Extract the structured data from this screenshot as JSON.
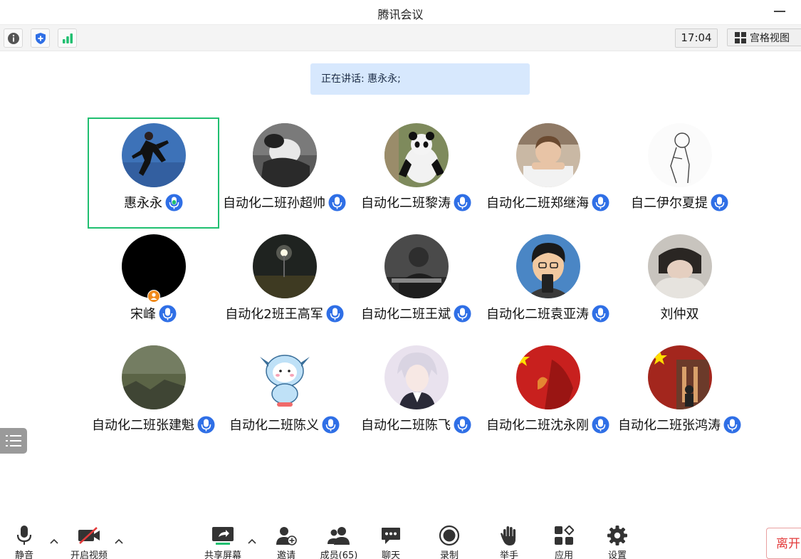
{
  "window": {
    "title": "腾讯会议"
  },
  "infobar": {
    "time": "17:04",
    "grid_view_label": "宫格视图"
  },
  "speaking": {
    "text": "正在讲话: 惠永永;"
  },
  "participants": [
    {
      "name": "惠永永",
      "mic": "speaking"
    },
    {
      "name": "自动化二班孙超帅",
      "mic": "on"
    },
    {
      "name": "自动化二班黎涛",
      "mic": "on"
    },
    {
      "name": "自动化二班郑继海",
      "mic": "on"
    },
    {
      "name": "自二伊尔夏提",
      "mic": "on"
    },
    {
      "name": "宋峰",
      "mic": "on",
      "host": true
    },
    {
      "name": "自动化2班王高军",
      "mic": "on"
    },
    {
      "name": "自动化二班王斌",
      "mic": "on"
    },
    {
      "name": "自动化二班袁亚涛",
      "mic": "on"
    },
    {
      "name": "刘仲双",
      "mic": "none"
    },
    {
      "name": "自动化二班张建魁",
      "mic": "on"
    },
    {
      "name": "自动化二班陈义",
      "mic": "on"
    },
    {
      "name": "自动化二班陈飞",
      "mic": "on"
    },
    {
      "name": "自动化二班沈永刚",
      "mic": "on"
    },
    {
      "name": "自动化二班张鸿涛",
      "mic": "on"
    }
  ],
  "toolbar": {
    "mute": "静音",
    "video": "开启视频",
    "share": "共享屏幕",
    "invite": "邀请",
    "members": "成员(65)",
    "chat": "聊天",
    "record": "录制",
    "raise_hand": "举手",
    "apps": "应用",
    "settings": "设置",
    "leave": "离开"
  },
  "colors": {
    "active_border": "#1fbf70",
    "mic_blue": "#2f6fe6",
    "mic_green": "#1fbf70",
    "speaking_bg": "#d7e8fd",
    "leave_red": "#e33b3b",
    "share_green": "#1fbf70"
  }
}
